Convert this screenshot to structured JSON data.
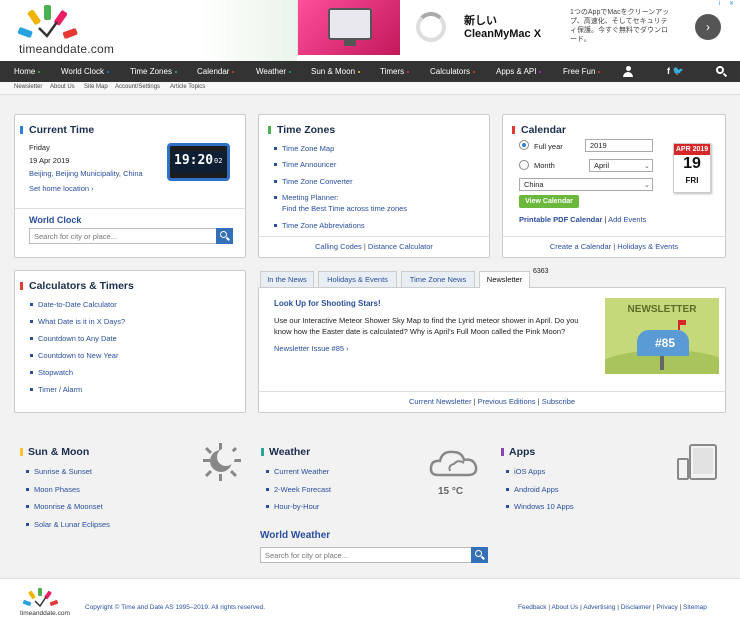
{
  "header": {
    "logo_text": "timeanddate.com",
    "ad": {
      "headline": "新しい",
      "brand": "CleanMyMac X",
      "tagline": "1つのAppでMacをクリーンアップ、高速化、そしてセキュリティ保護。今すぐ無料でダウンロード。",
      "info": "i",
      "close": "✕"
    }
  },
  "nav": {
    "items": [
      {
        "label": "Home",
        "color": "#4caf50"
      },
      {
        "label": "World Clock",
        "color": "#2e7dd7"
      },
      {
        "label": "Time Zones",
        "color": "#4caf50"
      },
      {
        "label": "Calendar",
        "color": "#e53935"
      },
      {
        "label": "Weather",
        "color": "#26a69a"
      },
      {
        "label": "Sun & Moon",
        "color": "#fbc02d"
      },
      {
        "label": "Timers",
        "color": "#e53935"
      },
      {
        "label": "Calculators",
        "color": "#e53935"
      },
      {
        "label": "Apps & API",
        "color": "#8e44ad"
      },
      {
        "label": "Free Fun",
        "color": "#e53935"
      }
    ],
    "social": "f 🐦",
    "subnav": [
      "Newsletter",
      "About Us",
      "Site Map",
      "Account/Settings",
      "Article Topics"
    ]
  },
  "current_time": {
    "title": "Current Time",
    "day": "Friday",
    "date": "19 Apr 2019",
    "location": "Beijing, Beijing Municipality, China",
    "set_home": "Set home location",
    "clock": "19:20",
    "clock_sec": "02",
    "world_clock_title": "World Clock",
    "search_placeholder": "Search for city or place..."
  },
  "time_zones": {
    "title": "Time Zones",
    "links": [
      "Time Zone Map",
      "Time Announcer",
      "Time Zone Converter",
      "Meeting Planner:",
      "Find the Best Time across time zones",
      "Time Zone Abbreviations"
    ],
    "footer_a": "Calling Codes",
    "footer_b": "Distance Calculator",
    "sep": "|"
  },
  "calendar": {
    "title": "Calendar",
    "opt_full_year": "Full year",
    "opt_month": "Month",
    "year_value": "2019",
    "month_value": "April",
    "country_value": "China",
    "view_button": "View Calendar",
    "printable": "Printable PDF Calendar",
    "add_events": "Add Events",
    "icon_month": "APR 2019",
    "icon_day": "19",
    "icon_dow": "FRI",
    "footer_a": "Create a Calendar",
    "footer_b": "Holidays & Events",
    "sep": "|"
  },
  "calculators": {
    "title": "Calculators & Timers",
    "links": [
      "Date-to-Date Calculator",
      "What Date is it in X Days?",
      "Countdown to Any Date",
      "Countdown to New Year",
      "Stopwatch",
      "Timer / Alarm"
    ]
  },
  "news": {
    "tabs": [
      "In the News",
      "Holidays & Events",
      "Time Zone News",
      "Newsletter"
    ],
    "counter": "6363",
    "headline": "Look Up for Shooting Stars!",
    "body": "Use our Interactive Meteor Shower Sky Map to find the Lyrid meteor shower in April. Do you know how the Easter date is calculated? Why is April's Full Moon called the Pink Moon?",
    "issue": "Newsletter Issue #85",
    "image_title": "NEWSLETTER",
    "image_num": "#85",
    "footer": [
      "Current Newsletter",
      "Previous Editions",
      "Subscribe"
    ],
    "sep": "|"
  },
  "sun_moon": {
    "title": "Sun & Moon",
    "links": [
      "Sunrise & Sunset",
      "Moon Phases",
      "Moonrise & Moonset",
      "Solar & Lunar Eclipses"
    ]
  },
  "weather": {
    "title": "Weather",
    "links": [
      "Current Weather",
      "2-Week Forecast",
      "Hour-by-Hour"
    ],
    "temp": "15 °C",
    "world_weather_title": "World Weather",
    "search_placeholder": "Search for city or place..."
  },
  "apps": {
    "title": "Apps",
    "links": [
      "iOS Apps",
      "Android Apps",
      "Windows 10 Apps"
    ]
  },
  "footer": {
    "logo_text": "timeanddate.com",
    "copyright": "Copyright © Time and Date AS 1995–2019. All rights reserved.",
    "links": [
      "Feedback",
      "About Us",
      "Advertising",
      "Disclaimer",
      "Privacy",
      "Sitemap"
    ],
    "sep": "|"
  }
}
